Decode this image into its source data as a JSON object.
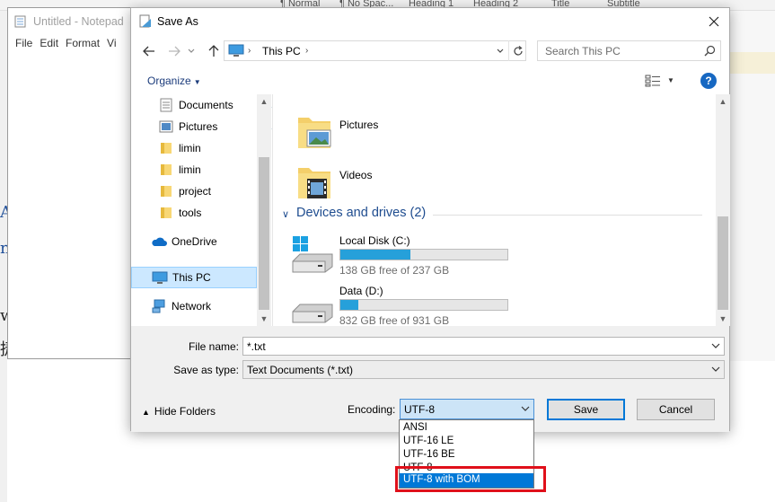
{
  "word": {
    "styles": [
      "¶ Normal",
      "¶ No Spac...",
      "Heading 1",
      "Heading 2",
      "Title",
      "Subtitle"
    ],
    "left_chars": [
      "A",
      "n",
      "w",
      "捷"
    ]
  },
  "notepad": {
    "title": "Untitled - Notepad",
    "menu": [
      "File",
      "Edit",
      "Format",
      "Vi"
    ]
  },
  "dialog": {
    "title": "Save As",
    "breadcrumb": "This PC",
    "search_placeholder": "Search This PC",
    "organize_label": "Organize",
    "help_label": "?",
    "nav_items": [
      {
        "label": "Documents",
        "icon": "documents-icon",
        "pinned": true
      },
      {
        "label": "Pictures",
        "icon": "pictures-icon",
        "pinned": true
      },
      {
        "label": "limin",
        "icon": "folder-icon",
        "pinned": false
      },
      {
        "label": "limin",
        "icon": "folder-icon",
        "pinned": false
      },
      {
        "label": "project",
        "icon": "folder-icon",
        "pinned": false
      },
      {
        "label": "tools",
        "icon": "folder-icon",
        "pinned": false
      },
      {
        "label": "OneDrive",
        "icon": "onedrive-icon",
        "pinned": false
      },
      {
        "label": "This PC",
        "icon": "this-pc-icon",
        "pinned": false,
        "selected": true
      },
      {
        "label": "Network",
        "icon": "network-icon",
        "pinned": false
      }
    ],
    "folders": [
      {
        "label": "Pictures",
        "icon": "pictures-folder-icon"
      },
      {
        "label": "Videos",
        "icon": "videos-folder-icon"
      }
    ],
    "drives_header": "Devices and drives (2)",
    "drives": [
      {
        "label": "Local Disk (C:)",
        "free_text": "138 GB free of 237 GB",
        "used_fraction": 0.418,
        "icon": "windows-drive-icon"
      },
      {
        "label": "Data (D:)",
        "free_text": "832 GB free of 931 GB",
        "used_fraction": 0.106,
        "icon": "hard-drive-icon"
      }
    ],
    "file_name_label": "File name:",
    "file_name_value": "*.txt",
    "save_type_label": "Save as type:",
    "save_type_value": "Text Documents (*.txt)",
    "hide_folders_label": "Hide Folders",
    "encoding_label": "Encoding:",
    "encoding_value": "UTF-8",
    "save_label": "Save",
    "cancel_label": "Cancel",
    "encoding_options": [
      "ANSI",
      "UTF-16 LE",
      "UTF-16 BE",
      "UTF-8",
      "UTF-8 with BOM"
    ],
    "highlighted_option": "UTF-8 with BOM"
  },
  "colors": {
    "accent": "#0078d7",
    "drive_bar": "#26a0da",
    "highlight_box": "#e0101a",
    "selection": "#cce8ff",
    "link_blue": "#1e4c8f"
  }
}
